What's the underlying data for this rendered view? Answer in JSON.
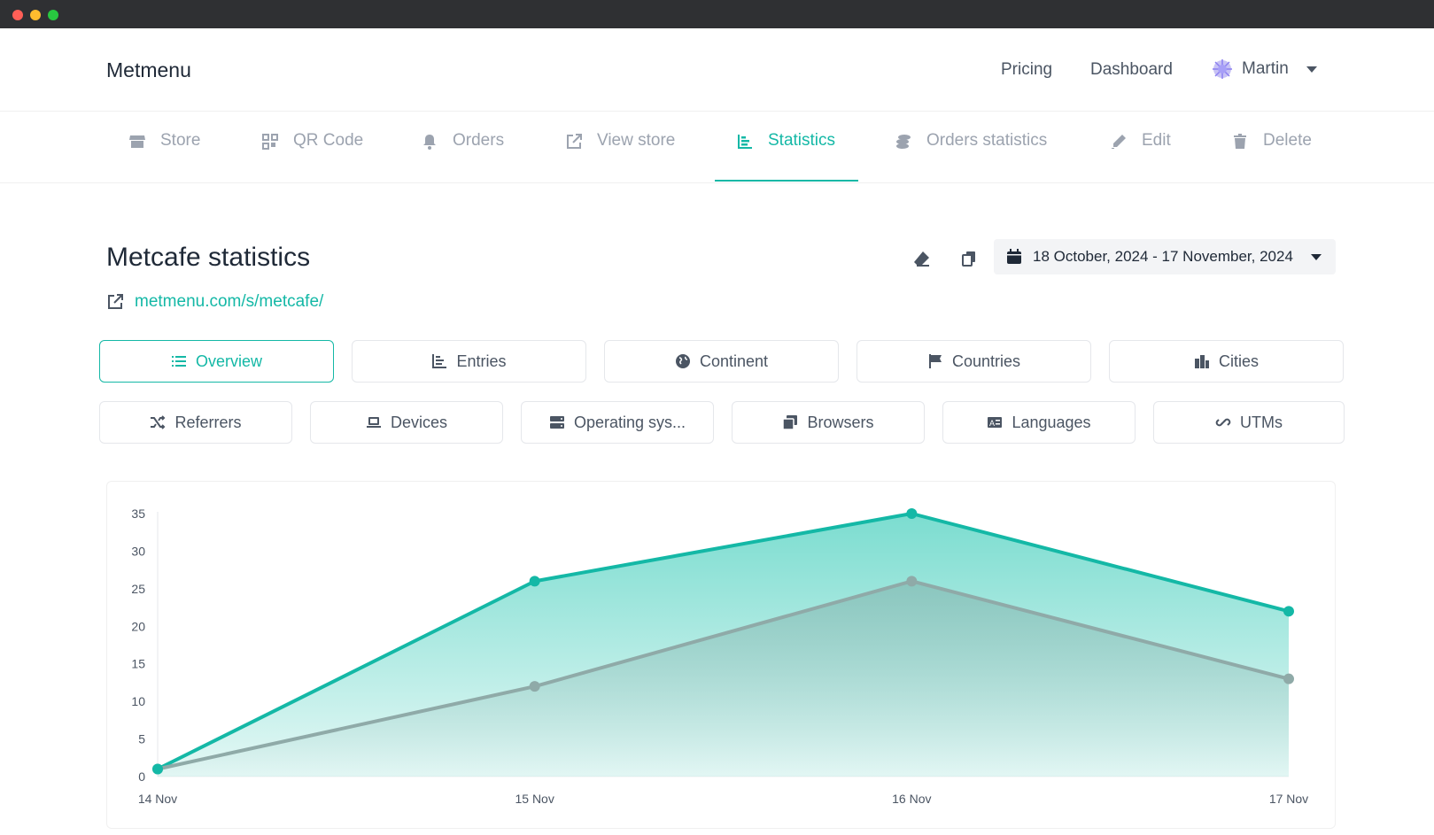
{
  "brand": "Metmenu",
  "nav": {
    "pricing": "Pricing",
    "dashboard": "Dashboard",
    "user": "Martin"
  },
  "tabs": [
    {
      "label": "Store",
      "icon": "store-icon"
    },
    {
      "label": "QR Code",
      "icon": "qrcode-icon"
    },
    {
      "label": "Orders",
      "icon": "bell-icon"
    },
    {
      "label": "View store",
      "icon": "external-link-icon"
    },
    {
      "label": "Statistics",
      "icon": "chart-icon",
      "active": true
    },
    {
      "label": "Orders statistics",
      "icon": "coins-icon"
    },
    {
      "label": "Edit",
      "icon": "pencil-icon"
    },
    {
      "label": "Delete",
      "icon": "trash-icon"
    }
  ],
  "page": {
    "title": "Metcafe statistics",
    "link": "metmenu.com/s/metcafe/",
    "date_range": "18 October, 2024 - 17 November, 2024"
  },
  "segments_row1": [
    {
      "label": "Overview",
      "icon": "list-icon",
      "active": true
    },
    {
      "label": "Entries",
      "icon": "chart-icon"
    },
    {
      "label": "Continent",
      "icon": "globe-icon"
    },
    {
      "label": "Countries",
      "icon": "flag-icon"
    },
    {
      "label": "Cities",
      "icon": "city-icon"
    }
  ],
  "segments_row2": [
    {
      "label": "Referrers",
      "icon": "shuffle-icon"
    },
    {
      "label": "Devices",
      "icon": "laptop-icon"
    },
    {
      "label": "Operating sys...",
      "icon": "server-icon"
    },
    {
      "label": "Browsers",
      "icon": "window-icon"
    },
    {
      "label": "Languages",
      "icon": "language-icon"
    },
    {
      "label": "UTMs",
      "icon": "link-icon"
    }
  ],
  "colors": {
    "accent": "#14b8a6",
    "secondary": "#8faaa8"
  },
  "chart_data": {
    "type": "area",
    "categories": [
      "14 Nov",
      "15 Nov",
      "16 Nov",
      "17 Nov"
    ],
    "series": [
      {
        "values": [
          1,
          26,
          35,
          22
        ]
      },
      {
        "values": [
          1,
          12,
          26,
          13
        ]
      }
    ],
    "y_ticks": [
      0,
      5,
      10,
      15,
      20,
      25,
      30,
      35
    ],
    "ylim": [
      0,
      35
    ],
    "grid": false,
    "legend": "none"
  }
}
